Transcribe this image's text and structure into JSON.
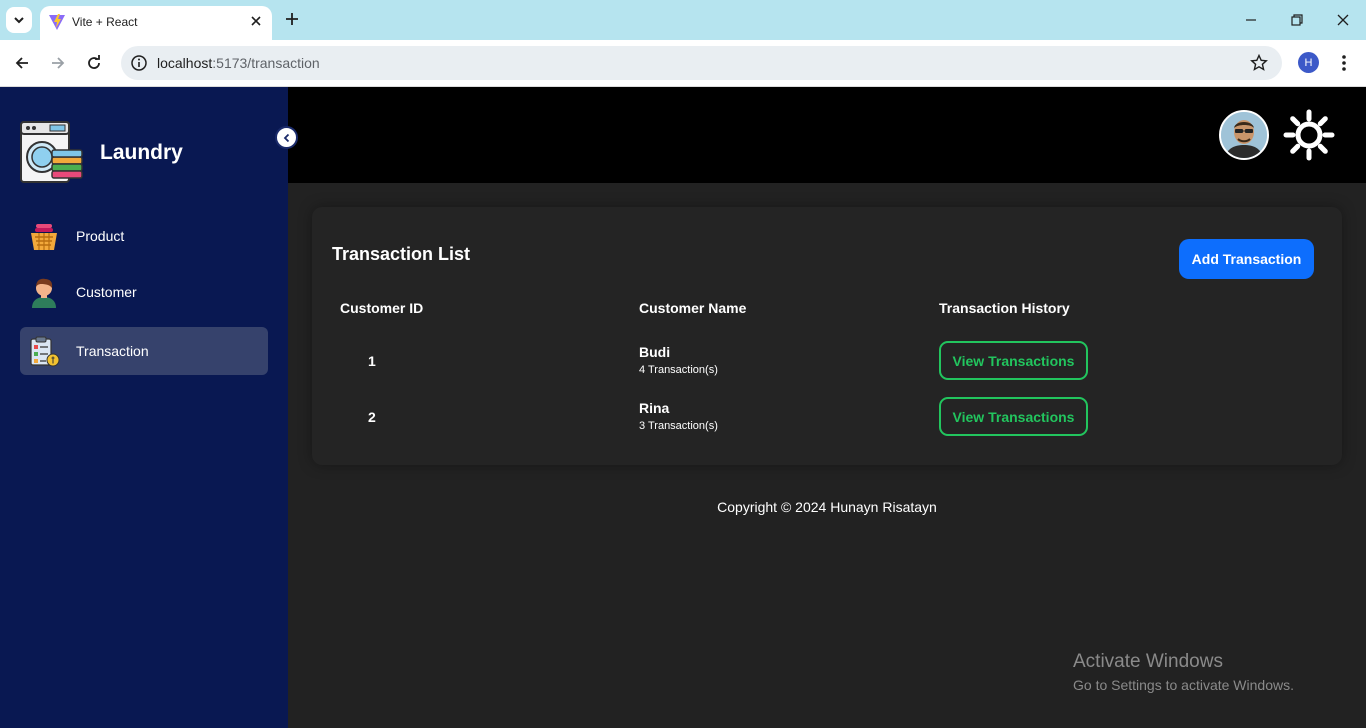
{
  "browser": {
    "tab_title": "Vite + React",
    "url_host": "localhost",
    "url_path": ":5173/transaction",
    "profile_initial": "H"
  },
  "sidebar": {
    "brand": "Laundry",
    "items": [
      {
        "label": "Product",
        "icon": "basket-icon"
      },
      {
        "label": "Customer",
        "icon": "customer-icon"
      },
      {
        "label": "Transaction",
        "icon": "clipboard-icon",
        "active": true
      }
    ]
  },
  "main": {
    "title": "Transaction List",
    "add_button": "Add Transaction",
    "columns": [
      "Customer ID",
      "Customer Name",
      "Transaction History"
    ],
    "rows": [
      {
        "id": "1",
        "name": "Budi",
        "count": "4 Transaction(s)",
        "action": "View Transactions"
      },
      {
        "id": "2",
        "name": "Rina",
        "count": "3 Transaction(s)",
        "action": "View Transactions"
      }
    ],
    "footer": "Copyright © 2024 Hunayn Risatayn"
  },
  "watermark": {
    "title": "Activate Windows",
    "subtitle": "Go to Settings to activate Windows."
  },
  "colors": {
    "sidebar_bg": "#091852",
    "active_item_bg": "#36426c",
    "topbar_bg": "#000000",
    "content_bg": "#222222",
    "primary_button": "#0d6efd",
    "success_outline": "#22c55e"
  }
}
